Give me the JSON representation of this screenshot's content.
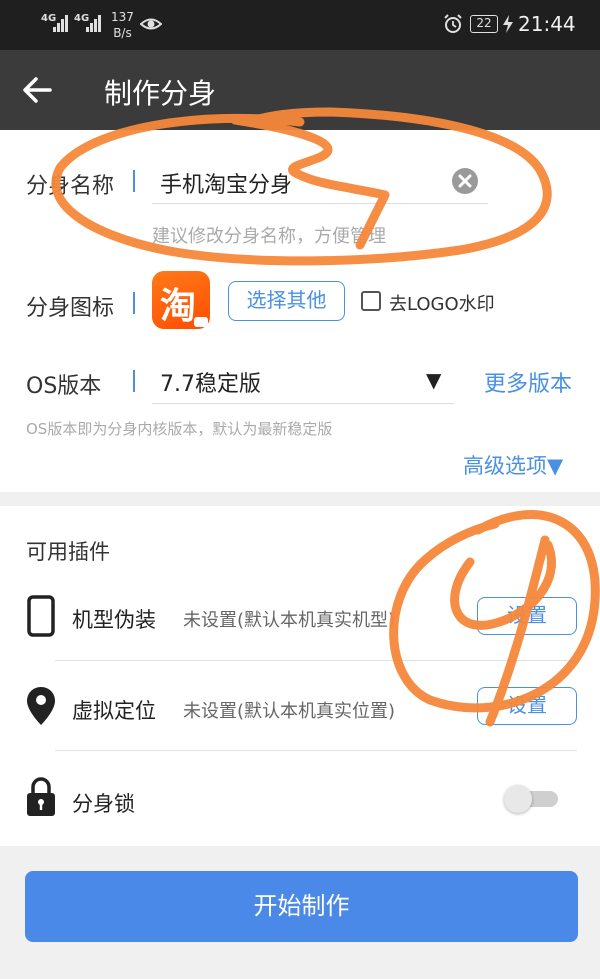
{
  "status_bar": {
    "signal_1": "4G",
    "signal_2": "4G",
    "net_speed_value": "137",
    "net_speed_unit": "B/s",
    "battery": "22",
    "time": "21:44"
  },
  "app_bar": {
    "title": "制作分身"
  },
  "form": {
    "name_label": "分身名称",
    "name_value": "手机淘宝分身",
    "name_hint": "建议修改分身名称，方便管理",
    "icon_label": "分身图标",
    "icon_glyph": "淘",
    "choose_other_label": "选择其他",
    "remove_logo_label": "去LOGO水印",
    "os_label": "OS版本",
    "os_value": "7.7稳定版",
    "more_versions_label": "更多版本",
    "os_hint": "OS版本即为分身内核版本，默认为最新稳定版",
    "advanced_label": "高级选项▼"
  },
  "plugins": {
    "title": "可用插件",
    "items": [
      {
        "label": "机型伪装",
        "status": "未设置(默认本机真实机型)",
        "button": "设置"
      },
      {
        "label": "虚拟定位",
        "status": "未设置(默认本机真实位置)",
        "button": "设置"
      },
      {
        "label": "分身锁"
      }
    ]
  },
  "start_button_label": "开始制作",
  "colors": {
    "accent": "#4a90e2",
    "primary_button": "#4a89e8",
    "app_bar": "#3b3b3b",
    "status_bar": "#1f1f1f",
    "annotation_orange": "#f5883a"
  }
}
